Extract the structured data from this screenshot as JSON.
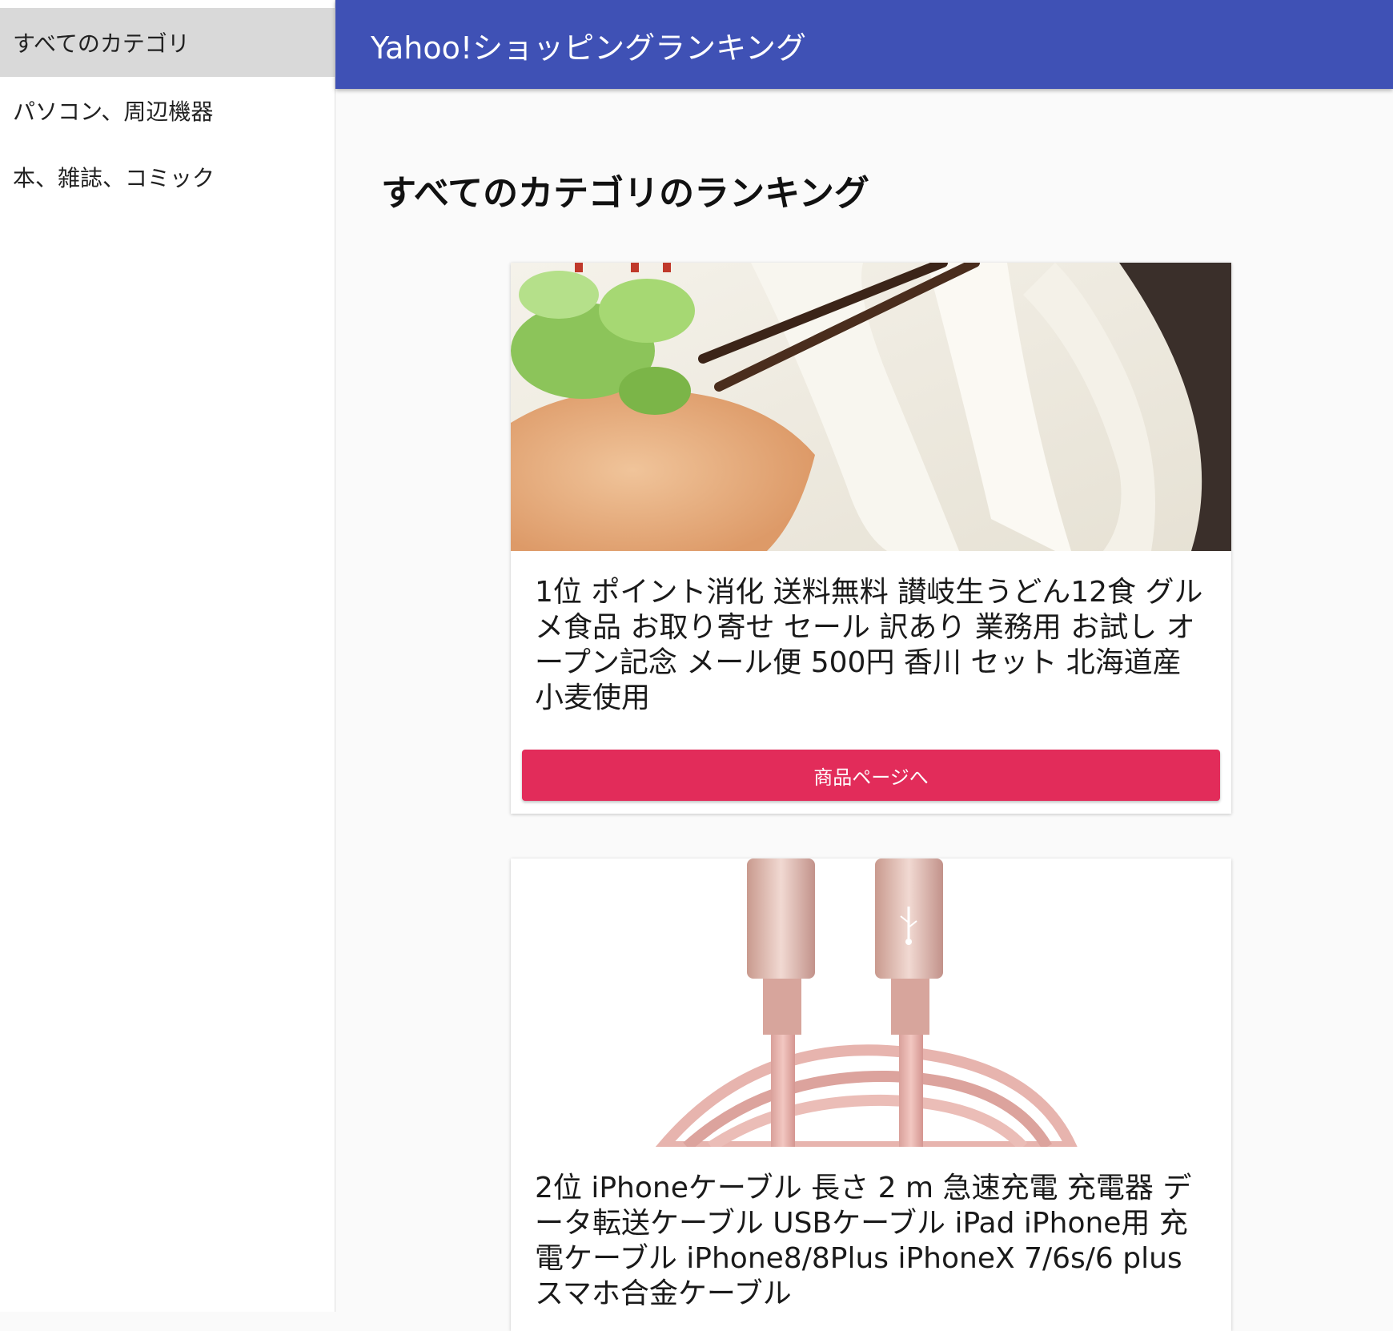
{
  "sidebar": {
    "items": [
      {
        "label": "すべてのカテゴリ",
        "active": true
      },
      {
        "label": "パソコン、周辺機器",
        "active": false
      },
      {
        "label": "本、雑誌、コミック",
        "active": false
      }
    ]
  },
  "appbar": {
    "title": "Yahoo!ショッピングランキング",
    "color": "#3f51b5"
  },
  "main": {
    "heading": "すべてのカテゴリのランキング",
    "products": [
      {
        "title": "1位 ポイント消化 送料無料 讃岐生うどん12食 グルメ食品 お取り寄せ セール 訳あり 業務用 お試し オープン記念 メール便 500円 香川 セット 北海道産小麦使用",
        "image": "udon-noodles-photo",
        "button_label": "商品ページへ"
      },
      {
        "title": "2位 iPhoneケーブル 長さ 2 m 急速充電 充電器 データ転送ケーブル USBケーブル iPad iPhone用 充電ケーブル iPhone8/8Plus iPhoneX 7/6s/6 plus スマホ合金ケーブル",
        "image": "pink-lightning-cable-photo"
      }
    ],
    "button_color": "#e22c5a"
  }
}
